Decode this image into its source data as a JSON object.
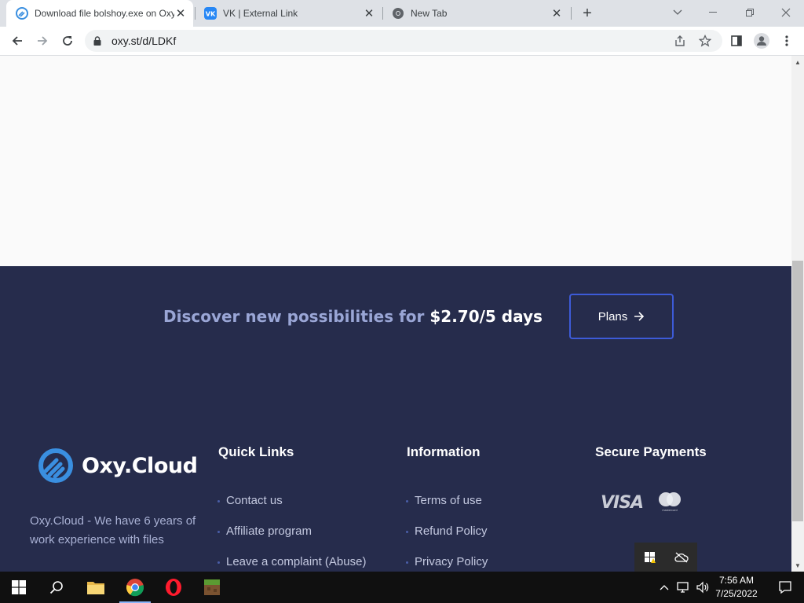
{
  "browser": {
    "tabs": [
      {
        "label": "Download file bolshoy.exe on Oxy.Cloud",
        "icon": "oxy-favicon",
        "active": true
      },
      {
        "label": "VK | External Link",
        "icon": "vk-favicon",
        "active": false
      },
      {
        "label": "New Tab",
        "icon": "chrome-favicon",
        "active": false
      }
    ],
    "url": "oxy.st/d/LDKf"
  },
  "page": {
    "promo": {
      "text": "Discover new possibilities for ",
      "price": "$2.70/5 days"
    },
    "plans_button": "Plans",
    "logo_name": "Oxy.Cloud",
    "about": "Oxy.Cloud - We have 6 years of work experience with files",
    "quick_links": {
      "title": "Quick Links",
      "items": [
        "Contact us",
        "Affiliate program",
        "Leave a complaint (Abuse)"
      ]
    },
    "information": {
      "title": "Information",
      "items": [
        "Terms of use",
        "Refund Policy",
        "Privacy Policy"
      ]
    },
    "payments": {
      "title": "Secure Payments",
      "visa": "VISA",
      "mastercard": "mastercard"
    }
  },
  "taskbar": {
    "time": "7:56 AM",
    "date": "7/25/2022",
    "apps": [
      "file-explorer",
      "chrome",
      "opera",
      "minecraft"
    ]
  },
  "colors": {
    "footer_bg": "#262c4c",
    "accent": "#3d5bd8",
    "promo_text": "#9aa6d6"
  }
}
